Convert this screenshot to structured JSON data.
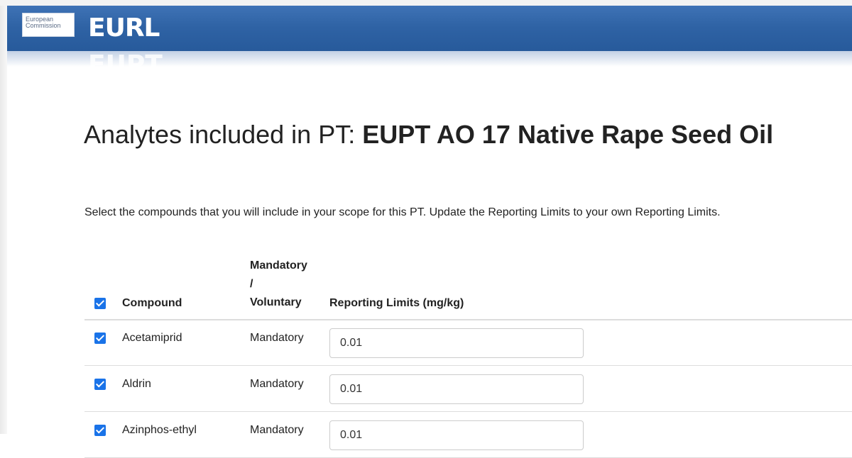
{
  "header": {
    "logo_line1": "European",
    "logo_line2": "Commission",
    "site_name": "EURL",
    "site_name_cut": "EUPT"
  },
  "page": {
    "title_prefix": "Analytes included in PT: ",
    "title_pt": "EUPT AO 17 Native Rape Seed Oil",
    "instructions": "Select the compounds that you will include in your scope for this PT. Update the Reporting Limits to your own Reporting Limits."
  },
  "table": {
    "select_all_checked": true,
    "columns": {
      "compound": "Compound",
      "mandatory_line1": "Mandatory",
      "mandatory_line2": "/",
      "mandatory_line3": "Voluntary",
      "reporting_limits": "Reporting Limits (mg/kg)"
    },
    "rows": [
      {
        "checked": true,
        "compound": "Acetamiprid",
        "type": "Mandatory",
        "reporting_limit": "0.01"
      },
      {
        "checked": true,
        "compound": "Aldrin",
        "type": "Mandatory",
        "reporting_limit": "0.01"
      },
      {
        "checked": true,
        "compound": "Azinphos-ethyl",
        "type": "Mandatory",
        "reporting_limit": "0.01"
      }
    ]
  },
  "colors": {
    "banner": "#2f63a5",
    "checkbox": "#1a73e8",
    "text": "#222222"
  }
}
